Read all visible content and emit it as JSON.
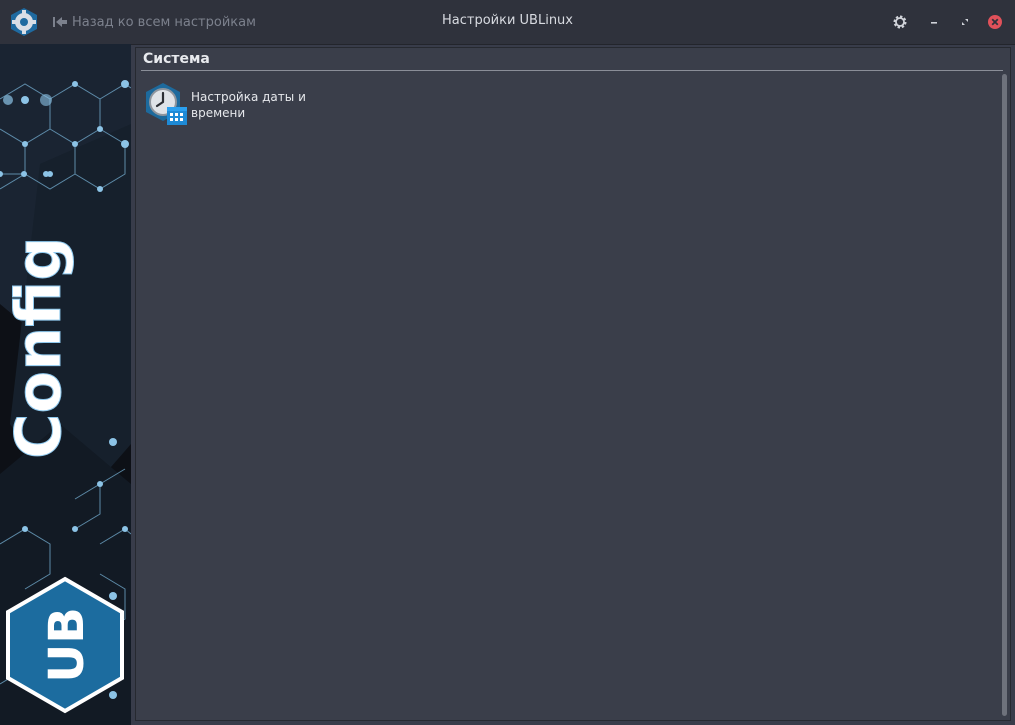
{
  "titlebar": {
    "title": "Настройки UBLinux",
    "back_label": "Назад ко всем настройкам",
    "app_icon": "settings-app-icon",
    "controls": [
      "gear-icon",
      "minimize-icon",
      "restore-icon",
      "close-icon"
    ]
  },
  "banner": {
    "logo_text": "Config",
    "logo_badge": "UB"
  },
  "main": {
    "section_title": "Система",
    "items": [
      {
        "label": "Настройка даты и времени",
        "icon": "date-time-settings-icon"
      }
    ]
  },
  "colors": {
    "accent": "#1b6fa8",
    "close": "#e0515a",
    "background": "#383c4a"
  }
}
